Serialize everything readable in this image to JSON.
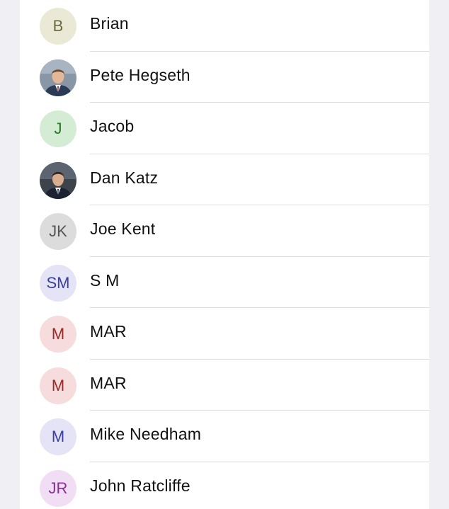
{
  "contacts": [
    {
      "initials": "B",
      "name": "Brian",
      "avatar_type": "initials",
      "bg": "#eae9d6",
      "fg": "#6e6a3e"
    },
    {
      "initials": "",
      "name": "Pete Hegseth",
      "avatar_type": "photo",
      "photo_icon": "person-photo-icon",
      "bg": "#7d8a98"
    },
    {
      "initials": "J",
      "name": "Jacob",
      "avatar_type": "initials",
      "bg": "#d3ecd3",
      "fg": "#1f7d1f"
    },
    {
      "initials": "",
      "name": "Dan Katz",
      "avatar_type": "photo",
      "photo_icon": "person-photo-icon",
      "bg": "#4a5058"
    },
    {
      "initials": "JK",
      "name": "Joe Kent",
      "avatar_type": "initials",
      "bg": "#dcdcdc",
      "fg": "#555555"
    },
    {
      "initials": "SM",
      "name": "S M",
      "avatar_type": "initials",
      "bg": "#e4e4f6",
      "fg": "#3a3fa0"
    },
    {
      "initials": "M",
      "name": "MAR",
      "avatar_type": "initials",
      "bg": "#f6dcdc",
      "fg": "#9a2a2a"
    },
    {
      "initials": "M",
      "name": "MAR",
      "avatar_type": "initials",
      "bg": "#f6dcdc",
      "fg": "#9a2a2a"
    },
    {
      "initials": "M",
      "name": "Mike Needham",
      "avatar_type": "initials",
      "bg": "#e4e4f6",
      "fg": "#3a3fa0"
    },
    {
      "initials": "JR",
      "name": "John Ratcliffe",
      "avatar_type": "initials",
      "bg": "#f1def4",
      "fg": "#8a2c9a"
    }
  ]
}
